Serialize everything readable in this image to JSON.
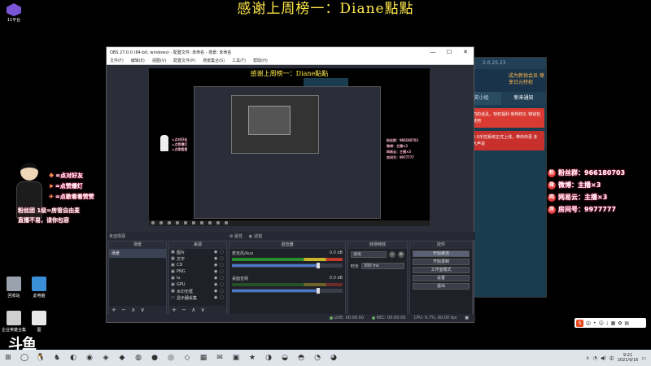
{
  "banner": {
    "text": "感谢上周榜一：Diane點點"
  },
  "corner": {
    "label": "11平台"
  },
  "left_overlay": {
    "notes": [
      {
        "icon": "gift-icon",
        "text": "=点对好友"
      },
      {
        "icon": "fish-icon",
        "text": "=点赞爆灯"
      },
      {
        "icon": "rocket-icon",
        "text": "=点歌看看赞赞"
      }
    ],
    "sub_lines": [
      "粉丝团 1级=房管自由麦",
      "直播不易，请你包容"
    ]
  },
  "right_overlay": {
    "rows": [
      {
        "icon": "粉",
        "text": "粉丝群：966180703"
      },
      {
        "icon": "微",
        "text": "微博：主播×3"
      },
      {
        "icon": "网",
        "text": "网易云：主播×3"
      },
      {
        "icon": "房",
        "text": "房间号：9977777"
      }
    ]
  },
  "desktop_icons": [
    {
      "label": "回收站",
      "color": "#9aa3ad"
    },
    {
      "label": "此电脑",
      "color": "#3a8fd8"
    },
    {
      "label": "企业英雄合集",
      "color": "#cfcfcf"
    },
    {
      "label": "图",
      "color": "#e8e8e8"
    }
  ],
  "douyu_logo": "斗鱼",
  "bg_app": {
    "version": "2.0.25.23",
    "promo": "成为新锐会员 尊享日元特权",
    "tabs": [
      "抽奖小组",
      "新来通知"
    ],
    "cards": [
      "司的道具，特权福利 新特权礼 物钱包使用",
      "2.0乐控系统正式上线，带你你更 多大声说"
    ]
  },
  "obs": {
    "title": "OBS 27.0.0 (64-bit, windows) - 配置文件: 未命名 - 场景: 未命名",
    "window_buttons": [
      "—",
      "☐",
      "✕"
    ],
    "menu": [
      "文件(F)",
      "编辑(E)",
      "视图(V)",
      "配置文件(P)",
      "场景集合(S)",
      "工具(T)",
      "帮助(H)"
    ],
    "preview_title": "感谢上周榜一：Diane點點",
    "preview_notes": [
      "=点对好友",
      "=点赞爆灯",
      "=点歌看看"
    ],
    "preview_right": [
      "粉丝群：966180703",
      "微博：主播×3",
      "网易云：主播×3",
      "房间号：9977777"
    ],
    "no_source": "未选择源",
    "props_label": "属性",
    "filters_label": "滤镜",
    "docks": {
      "scenes_title": "场景",
      "sources_title": "来源",
      "mixer_title": "混音器",
      "transitions_title": "转场特效",
      "controls_title": "控件"
    },
    "scenes": [
      "场景"
    ],
    "sources": [
      {
        "icon": "▣",
        "name": "图片"
      },
      {
        "icon": "▣",
        "name": "文字"
      },
      {
        "icon": "▣",
        "name": "CD"
      },
      {
        "icon": "▣",
        "name": "PNG"
      },
      {
        "icon": "▣",
        "name": "lu"
      },
      {
        "icon": "▣",
        "name": "GPU"
      },
      {
        "icon": "▣",
        "name": "水印无框"
      },
      {
        "icon": "▭",
        "name": "显示器采集"
      }
    ],
    "mixer": [
      {
        "name": "麦克风/Aux",
        "db": "0.0 dB",
        "level": 0.78
      },
      {
        "name": "桌面音频",
        "db": "0.0 dB",
        "level": 0.78
      }
    ],
    "transition": {
      "type": "淡出",
      "duration_label": "时长",
      "duration": "300 ms"
    },
    "controls": [
      "开始推流",
      "开始录制",
      "工作室模式",
      "设置",
      "退出"
    ],
    "footer_btns": [
      "+",
      "−",
      "∧",
      "∨"
    ],
    "status": {
      "live": "LIVE: 00:00:00",
      "rec": "REC: 00:00:00",
      "cpu": "CPU: 0.7%, 60.00 fps"
    }
  },
  "ime": {
    "lang": "中"
  },
  "taskbar": {
    "apps": [
      "⊞",
      "◯",
      "🐧",
      "♞",
      "◐",
      "◉",
      "◈",
      "◆",
      "◍",
      "●",
      "◎",
      "◇",
      "▦",
      "✉",
      "▣",
      "★",
      "◑",
      "◒",
      "◓",
      "◔",
      "◕"
    ],
    "time": "9:21",
    "date": "2021/9/16"
  }
}
